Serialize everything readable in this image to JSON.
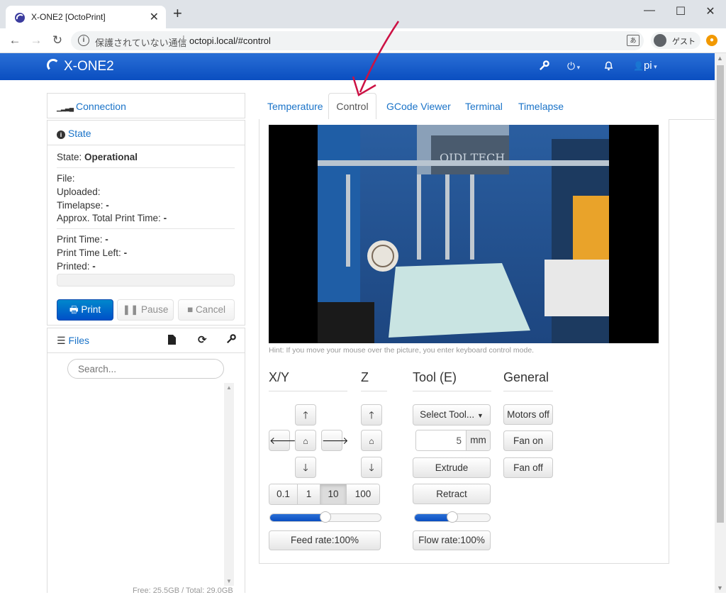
{
  "browser": {
    "tab_title": "X-ONE2 [OctoPrint]",
    "security_text": "保護されていない通信",
    "url": "octopi.local/#control",
    "profile_name": "ゲスト"
  },
  "navbar": {
    "brand": "X-ONE2",
    "user": "pi"
  },
  "sidebar": {
    "connection_label": "Connection",
    "state_label": "State",
    "state_prefix": "State:",
    "state_value": "Operational",
    "file_label": "File:",
    "uploaded_label": "Uploaded:",
    "timelapse_label": "Timelapse:",
    "timelapse_value": "-",
    "approx_label": "Approx. Total Print Time:",
    "approx_value": "-",
    "print_time_label": "Print Time:",
    "print_time_value": "-",
    "print_time_left_label": "Print Time Left:",
    "print_time_left_value": "-",
    "printed_label": "Printed:",
    "printed_value": "-",
    "buttons": {
      "print": "Print",
      "pause": "Pause",
      "cancel": "Cancel"
    },
    "files_label": "Files",
    "search_placeholder": "Search...",
    "free_space": "Free: 25.5GB / Total: 29.0GB"
  },
  "tabs": [
    "Temperature",
    "Control",
    "GCode Viewer",
    "Terminal",
    "Timelapse"
  ],
  "active_tab": "Control",
  "control": {
    "hint": "Hint: If you move your mouse over the picture, you enter keyboard control mode.",
    "xy_title": "X/Y",
    "z_title": "Z",
    "tool_title": "Tool (E)",
    "general_title": "General",
    "step_options": [
      "0.1",
      "1",
      "10",
      "100"
    ],
    "selected_step": "10",
    "feed_rate_label": "Feed rate:100%",
    "feed_rate_value": 0.5,
    "select_tool_label": "Select Tool...",
    "extrude_amount": "5",
    "extrude_unit": "mm",
    "extrude_label": "Extrude",
    "retract_label": "Retract",
    "flow_rate_label": "Flow rate:100%",
    "flow_rate_value": 0.5,
    "motors_off_label": "Motors off",
    "fan_on_label": "Fan on",
    "fan_off_label": "Fan off"
  },
  "webcam_image_text": "QIDI TECH",
  "colors": {
    "navbar": "#0a4ec0",
    "link": "#1a73c8",
    "primary": "#0a56c8"
  }
}
